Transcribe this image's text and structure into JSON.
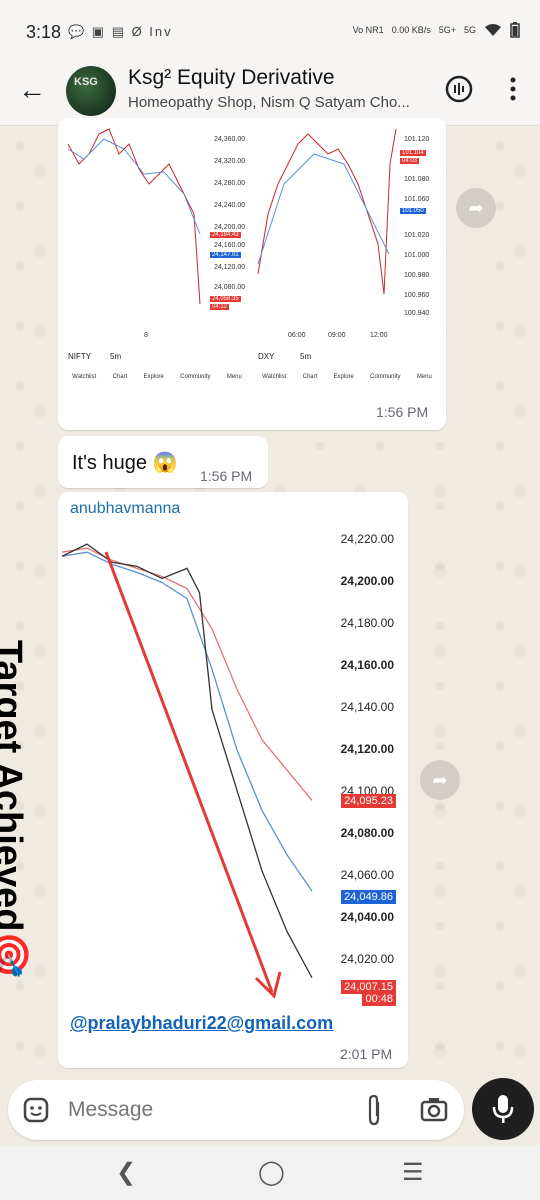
{
  "status_bar": {
    "time": "3:18",
    "app_icons": "💬 ▣ ▤ Ø Inv",
    "network": "Vo NR1",
    "speed": "0.00 KB/s",
    "signal1": "5G+",
    "signal2": "5G"
  },
  "header": {
    "title": "Ksg² Equity Derivative",
    "subtitle": "Homeopathy Shop, Nism Q Satyam Cho...",
    "avatar_text": "KSG"
  },
  "message1": {
    "time": "1:56 PM",
    "left_chart": {
      "symbol": "NIFTY",
      "interval": "5m",
      "y_labels": [
        "24,360.00",
        "24,320.00",
        "24,280.00",
        "24,240.00",
        "24,200.00",
        "24,160.00",
        "24,120.00",
        "24,080.00"
      ],
      "tag_red1": "24,184.43",
      "tag_blue": "24,147.01",
      "tag_red2": "24,058.35",
      "tag_red2_time": "04:12",
      "x_label": "8",
      "tabs": [
        "Watchlist",
        "Chart",
        "Explore",
        "Community",
        "Menu"
      ]
    },
    "right_chart": {
      "symbol": "DXY",
      "interval": "5m",
      "y_labels": [
        "101.120",
        "101.080",
        "101.060",
        "101.020",
        "101.000",
        "100.980",
        "100.960",
        "100.940"
      ],
      "tag_red": "101.104",
      "tag_red_time": "04:03",
      "tag_blue": "101.050",
      "x_labels": [
        "06:00",
        "09:00",
        "12:00"
      ],
      "tabs": [
        "Watchlist",
        "Chart",
        "Explore",
        "Community",
        "Menu"
      ]
    }
  },
  "message2": {
    "text": "It's huge 😱",
    "time": "1:56 PM"
  },
  "message3": {
    "sender": "anubhavmanna",
    "overlay_text": "Target Achieved🎯",
    "email": "@pralaybhaduri22@gmail.com",
    "time": "2:01 PM",
    "chart_data": {
      "type": "line",
      "title": "",
      "y_ticks": [
        "24,220.00",
        "24,200.00",
        "24,180.00",
        "24,160.00",
        "24,140.00",
        "24,120.00",
        "24,100.00",
        "24,080.00",
        "24,060.00",
        "24,040.00",
        "24,020.00"
      ],
      "bold_ticks": [
        "24,200.00",
        "24,160.00",
        "24,120.00",
        "24,080.00",
        "24,040.00"
      ],
      "ylim": [
        24000,
        24230
      ],
      "price_tags": [
        {
          "value": "24,095.23",
          "color": "#e53935"
        },
        {
          "value": "24,049.86",
          "color": "#1e63d6"
        },
        {
          "value": "24,007.15",
          "color": "#e53935",
          "time": "00:48"
        }
      ],
      "series": [
        {
          "color": "#e57373",
          "x": [
            0,
            10,
            20,
            30,
            40,
            50,
            60,
            70,
            80,
            90,
            100
          ],
          "y": [
            24218,
            24220,
            24214,
            24210,
            24206,
            24200,
            24180,
            24150,
            24125,
            24110,
            24095
          ]
        },
        {
          "color": "#5b8fd6",
          "x": [
            0,
            10,
            20,
            30,
            40,
            50,
            60,
            70,
            80,
            90,
            100
          ],
          "y": [
            24216,
            24218,
            24212,
            24208,
            24203,
            24195,
            24160,
            24120,
            24090,
            24068,
            24050
          ]
        },
        {
          "color": "#333333",
          "x": [
            0,
            10,
            20,
            30,
            40,
            50,
            55,
            60,
            70,
            80,
            90,
            100
          ],
          "y": [
            24216,
            24222,
            24213,
            24211,
            24205,
            24210,
            24198,
            24140,
            24100,
            24060,
            24030,
            24007
          ]
        }
      ]
    }
  },
  "composer": {
    "placeholder": "Message"
  },
  "colors": {
    "chat_bg": "#efeae2",
    "link": "#1463ba",
    "sender": "#1a6fa8"
  }
}
